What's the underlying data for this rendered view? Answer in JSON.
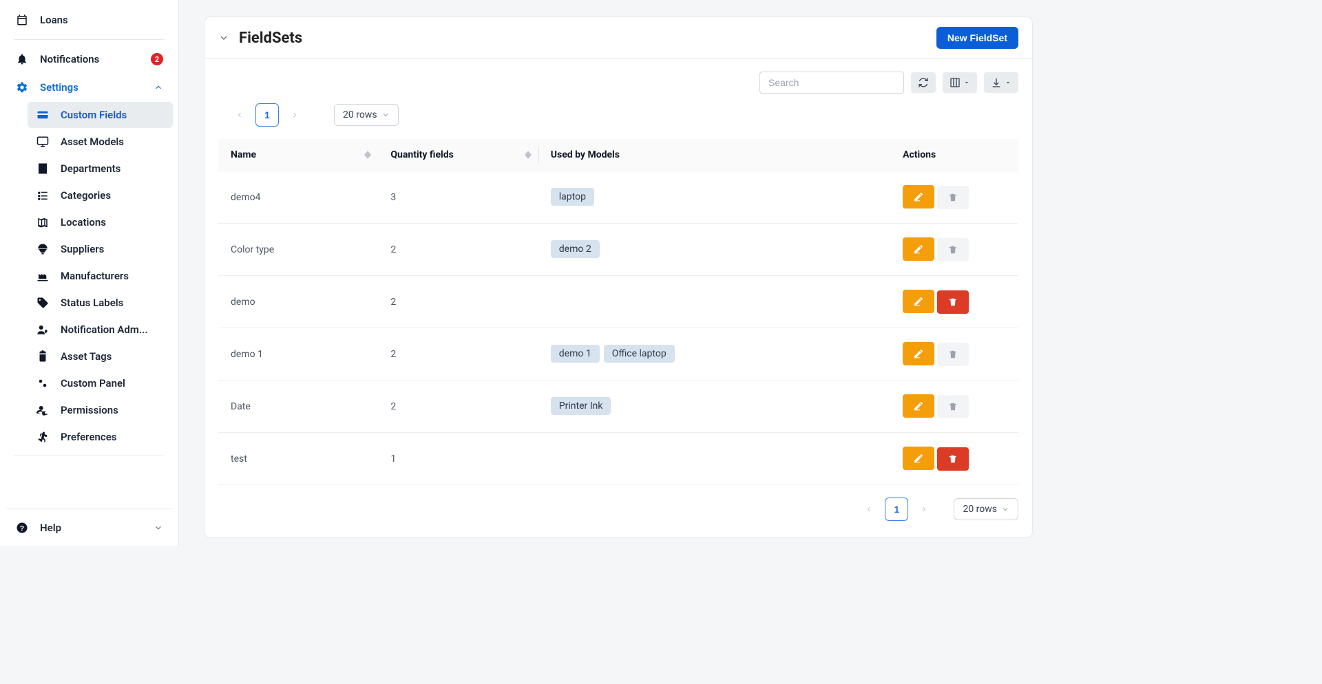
{
  "sidebar": {
    "loans": "Loans",
    "notifications": "Notifications",
    "notifications_badge": "2",
    "settings": "Settings",
    "sub": {
      "custom_fields": "Custom Fields",
      "asset_models": "Asset Models",
      "departments": "Departments",
      "categories": "Categories",
      "locations": "Locations",
      "suppliers": "Suppliers",
      "manufacturers": "Manufacturers",
      "status_labels": "Status Labels",
      "notification_admin": "Notification Adm...",
      "asset_tags": "Asset Tags",
      "custom_panel": "Custom Panel",
      "permissions": "Permissions",
      "preferences": "Preferences"
    },
    "help": "Help"
  },
  "page": {
    "title": "FieldSets",
    "new_button": "New FieldSet",
    "search_placeholder": "Search",
    "rows_label": "20 rows",
    "page_number": "1"
  },
  "columns": {
    "name": "Name",
    "qty": "Quantity fields",
    "used_by": "Used by Models",
    "actions": "Actions"
  },
  "rows": [
    {
      "name": "demo4",
      "qty": "3",
      "models": [
        "laptop"
      ],
      "deletable": false
    },
    {
      "name": "Color type",
      "qty": "2",
      "models": [
        "demo 2"
      ],
      "deletable": false
    },
    {
      "name": "demo",
      "qty": "2",
      "models": [],
      "deletable": true
    },
    {
      "name": "demo 1",
      "qty": "2",
      "models": [
        "demo 1",
        "Office laptop"
      ],
      "deletable": false
    },
    {
      "name": "Date",
      "qty": "2",
      "models": [
        "Printer Ink"
      ],
      "deletable": false
    },
    {
      "name": "test",
      "qty": "1",
      "models": [],
      "deletable": true
    }
  ]
}
